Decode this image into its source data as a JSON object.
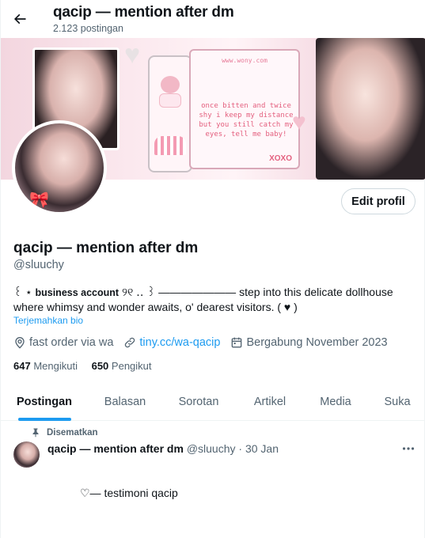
{
  "header": {
    "title": "qacip — mention after dm",
    "post_count": "2.123 postingan"
  },
  "banner": {
    "url_text": "www.wony.com",
    "poem": "once bitten and twice shy i keep my distance but you still catch my eyes, tell me baby!",
    "signoff": "XOXO"
  },
  "profile": {
    "edit_label": "Edit profil",
    "name": "qacip — mention after dm",
    "handle": "@sluuchy",
    "bio_lead": "꒰ ⋆ ",
    "bio_bold": "business account",
    "bio_rest": " ୨୧ ‥ ꒱ ——————— step into this delicate dollhouse where whimsy and wonder awaits, o' dearest visitors.  ( ♥ )",
    "translate_label": "Terjemahkan bio",
    "location": "fast order via wa",
    "website": "tiny.cc/wa-qacip",
    "joined": "Bergabung November 2023",
    "following_count": "647",
    "following_label": "Mengikuti",
    "followers_count": "650",
    "followers_label": "Pengikut"
  },
  "tabs": [
    {
      "label": "Postingan",
      "active": true
    },
    {
      "label": "Balasan",
      "active": false
    },
    {
      "label": "Sorotan",
      "active": false
    },
    {
      "label": "Artikel",
      "active": false
    },
    {
      "label": "Media",
      "active": false
    },
    {
      "label": "Suka",
      "active": false
    }
  ],
  "pinned_tweet": {
    "pinned_label": "Disematkan",
    "author_name": "qacip — mention after dm",
    "author_handle": "@sluuchy",
    "separator": "·",
    "date": "30 Jan",
    "text": "♡—  testimoni qacip"
  },
  "icons": {
    "back": "arrow-left-icon",
    "location": "map-pin-icon",
    "link": "link-icon",
    "calendar": "calendar-icon",
    "pin": "pin-icon",
    "more": "more-dots-icon"
  },
  "colors": {
    "accent": "#1d9bf0",
    "muted": "#536471",
    "text": "#0f1419"
  }
}
